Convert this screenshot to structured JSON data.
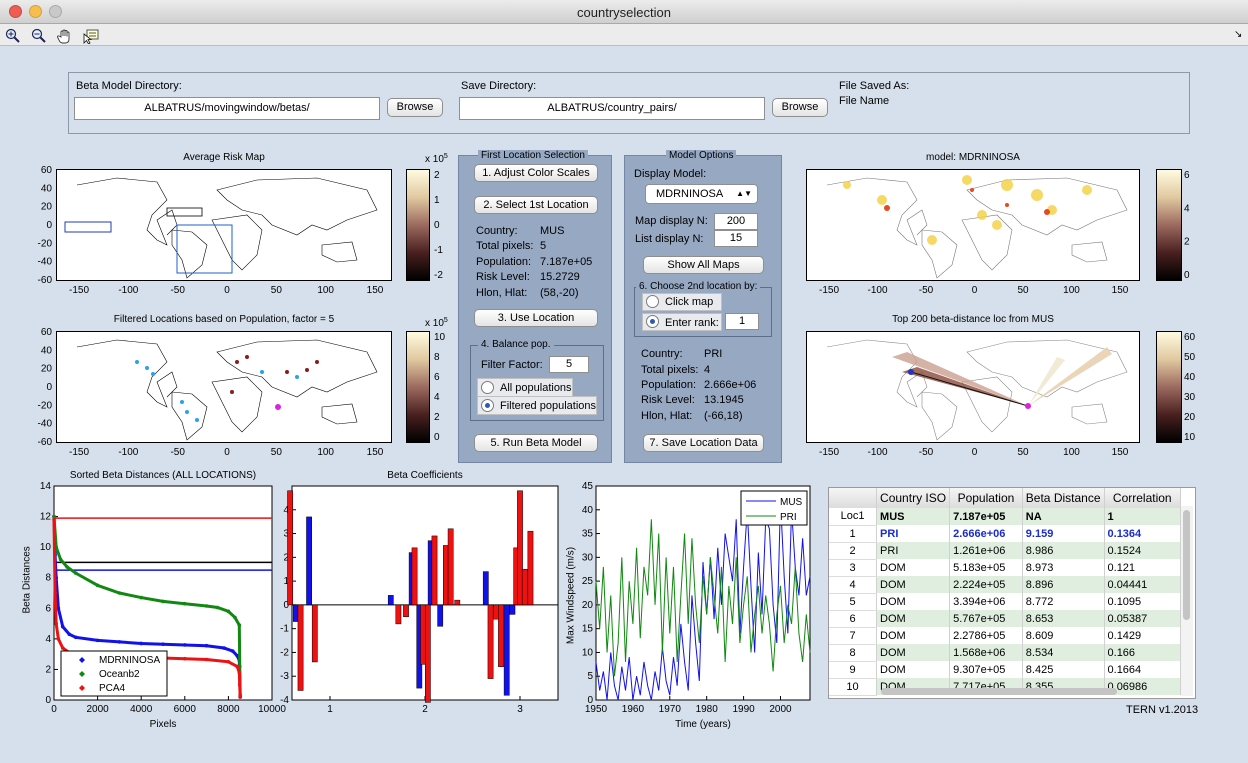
{
  "window": {
    "title": "countryselection"
  },
  "toolbar": {
    "icons": [
      "zoom-in-icon",
      "zoom-out-icon",
      "pan-hand-icon",
      "data-cursor-icon"
    ]
  },
  "dirs": {
    "beta_label": "Beta Model Directory:",
    "beta_value": "ALBATRUS/movingwindow/betas/",
    "browse": "Browse",
    "save_label": "Save Directory:",
    "save_value": "ALBATRUS/country_pairs/",
    "saved_as_label": "File Saved As:",
    "file_name": "File Name"
  },
  "maps": {
    "avg_title": "Average Risk Map",
    "avg_exp": "x 10",
    "avg_exp_pow": "5",
    "avg_cbar_ticks": [
      "2",
      "1",
      "0",
      "-1",
      "-2"
    ],
    "filtered_title": "Filtered Locations based on Population, factor = 5",
    "filtered_exp": "x 10",
    "filtered_exp_pow": "5",
    "filtered_cbar_ticks": [
      "10",
      "8",
      "6",
      "4",
      "2",
      "0"
    ],
    "model_title": "model: MDRNINOSA",
    "model_cbar_ticks": [
      "6",
      "4",
      "2",
      "0"
    ],
    "top_title": "Top 200 beta-distance loc from MUS",
    "top_cbar_ticks": [
      "60",
      "50",
      "40",
      "30",
      "20",
      "10"
    ],
    "lat_ticks": [
      "60",
      "40",
      "20",
      "0",
      "-20",
      "-40",
      "-60"
    ],
    "lon_ticks": [
      "-150",
      "-100",
      "-50",
      "0",
      "50",
      "100",
      "150"
    ]
  },
  "first_loc": {
    "title": "First Location Selection",
    "adjust": "1. Adjust Color Scales",
    "select": "2. Select 1st Location",
    "country_l": "Country:",
    "country_v": "MUS",
    "pixels_l": "Total pixels:",
    "pixels_v": "5",
    "pop_l": "Population:",
    "pop_v": "7.187e+05",
    "risk_l": "Risk Level:",
    "risk_v": "15.2729",
    "hlon_l": "Hlon, Hlat:",
    "hlon_v": "(58,-20)",
    "use": "3. Use Location",
    "balance_title": "4. Balance pop.",
    "filter_l": "Filter Factor:",
    "filter_v": "5",
    "all_pop": "All populations",
    "filtered_pop": "Filtered populations",
    "run": "5. Run Beta Model"
  },
  "model_opts": {
    "title": "Model Options",
    "display_l": "Display Model:",
    "display_v": "MDRNINOSA",
    "map_n_l": "Map display N:",
    "map_n_v": "200",
    "list_n_l": "List display N:",
    "list_n_v": "15",
    "show_all": "Show All Maps",
    "choose_title": "6. Choose 2nd location by:",
    "click_map": "Click map",
    "enter_rank": "Enter rank:",
    "rank_v": "1",
    "country_l": "Country:",
    "country_v": "PRI",
    "pixels_l": "Total pixels:",
    "pixels_v": "4",
    "pop_l": "Population:",
    "pop_v": "2.666e+06",
    "risk_l": "Risk Level:",
    "risk_v": "13.1945",
    "hlon_l": "Hlon, Hlat:",
    "hlon_v": "(-66,18)",
    "save": "7. Save Location Data"
  },
  "sorted_plot": {
    "title": "Sorted Beta Distances (ALL LOCATIONS)",
    "xlabel": "Pixels",
    "ylabel": "Beta Distances"
  },
  "beta_plot": {
    "title": "Beta Coefficients"
  },
  "ts_plot": {
    "xlabel": "Time (years)",
    "ylabel": "Max Windspeed (m/s)"
  },
  "table": {
    "headers": [
      "",
      "Country ISO",
      "Population",
      "Beta Distance",
      "Correlation"
    ],
    "rows": [
      [
        "Loc1",
        "MUS",
        "7.187e+05",
        "NA",
        "1"
      ],
      [
        "1",
        "PRI",
        "2.666e+06",
        "9.159",
        "0.1364"
      ],
      [
        "2",
        "PRI",
        "1.261e+06",
        "8.986",
        "0.1524"
      ],
      [
        "3",
        "DOM",
        "5.183e+05",
        "8.973",
        "0.121"
      ],
      [
        "4",
        "DOM",
        "2.224e+05",
        "8.896",
        "0.04441"
      ],
      [
        "5",
        "DOM",
        "3.394e+06",
        "8.772",
        "0.1095"
      ],
      [
        "6",
        "DOM",
        "5.767e+05",
        "8.653",
        "0.05387"
      ],
      [
        "7",
        "DOM",
        "2.2786+05",
        "8.609",
        "0.1429"
      ],
      [
        "8",
        "DOM",
        "1.568e+06",
        "8.534",
        "0.166"
      ],
      [
        "9",
        "DOM",
        "9.307e+05",
        "8.425",
        "0.1664"
      ],
      [
        "10",
        "DOM",
        "7.717e+05",
        "8.355",
        "0.06986"
      ]
    ]
  },
  "version": "TERN v1.2013",
  "chart_data": [
    {
      "type": "scatter",
      "title": "Sorted Beta Distances (ALL LOCATIONS)",
      "xlabel": "Pixels",
      "ylabel": "Beta Distances",
      "xlim": [
        0,
        10000
      ],
      "ylim": [
        0,
        14
      ],
      "x_ticks": [
        0,
        2000,
        4000,
        6000,
        8000,
        10000
      ],
      "y_ticks": [
        0,
        2,
        4,
        6,
        8,
        10,
        12,
        14
      ],
      "hlines": [
        {
          "y": 11.9,
          "color": "#ee1111"
        },
        {
          "y": 9.0,
          "color": "#000000"
        },
        {
          "y": 8.5,
          "color": "#1111ee"
        }
      ],
      "series": [
        {
          "name": "MDRNINOSA",
          "color": "#1111ee",
          "x": [
            0,
            50,
            100,
            200,
            400,
            700,
            1000,
            2000,
            3000,
            4000,
            5000,
            6000,
            7000,
            7800,
            8200,
            8400,
            8500,
            8520,
            8540
          ],
          "y": [
            12,
            9.5,
            8,
            6,
            4.8,
            4.3,
            4.1,
            3.9,
            3.8,
            3.7,
            3.65,
            3.6,
            3.55,
            3.4,
            3.2,
            2.9,
            2.6,
            1.5,
            0.2
          ]
        },
        {
          "name": "Oceanb2",
          "color": "#118811",
          "x": [
            0,
            100,
            300,
            600,
            1000,
            2000,
            3000,
            4000,
            5000,
            6000,
            7000,
            7500,
            8000,
            8300,
            8500,
            8520,
            8540
          ],
          "y": [
            12,
            10,
            9.2,
            8.7,
            8.3,
            7.5,
            7,
            6.7,
            6.45,
            6.3,
            6.15,
            6.05,
            5.8,
            5.4,
            4.9,
            2.2,
            0.3
          ]
        },
        {
          "name": "PCA4",
          "color": "#ee1111",
          "x": [
            0,
            50,
            100,
            200,
            400,
            700,
            1000,
            2000,
            3000,
            4000,
            5000,
            6000,
            7000,
            8000,
            8400,
            8500,
            8520,
            8540
          ],
          "y": [
            11.8,
            7,
            5,
            4,
            3.4,
            3.1,
            3,
            2.9,
            2.85,
            2.8,
            2.75,
            2.7,
            2.65,
            2.5,
            2.2,
            1.8,
            1.0,
            0.2
          ]
        }
      ],
      "legend": "bottom-left"
    },
    {
      "type": "bar",
      "title": "Beta Coefficients",
      "xlim": [
        0.6,
        3.4
      ],
      "ylim": [
        -4,
        5
      ],
      "x_ticks": [
        1,
        2,
        3
      ],
      "y_ticks": [
        -4,
        -3,
        -2,
        -1,
        0,
        1,
        2,
        3,
        4
      ],
      "bar_width": 0.055,
      "series": [
        {
          "name": "",
          "color": "#1111ee",
          "x": [
            0.64,
            0.78,
            1.64,
            1.86,
            1.94,
            2.06,
            2.16,
            2.64,
            2.86,
            2.92
          ],
          "values": [
            -0.7,
            3.7,
            0.4,
            2.2,
            -3.5,
            2.7,
            -0.9,
            1.4,
            -3.8,
            -0.4
          ]
        },
        {
          "name": "",
          "color": "#ee1111",
          "x": [
            0.58,
            0.69,
            0.84,
            1.72,
            1.8,
            1.89,
            1.98,
            2.03,
            2.1,
            2.22,
            2.27,
            2.34,
            2.69,
            2.75,
            2.8,
            2.96,
            3.0,
            3.05,
            3.11
          ],
          "values": [
            4.8,
            -3.6,
            -2.4,
            -0.8,
            -0.5,
            2.4,
            -2.5,
            -4.1,
            2.9,
            2.5,
            3.2,
            0.2,
            -3.1,
            -0.6,
            -2.6,
            2.4,
            4.8,
            1.5,
            3.1
          ]
        }
      ]
    },
    {
      "type": "line",
      "xlabel": "Time (years)",
      "ylabel": "Max Windspeed (m/s)",
      "xlim": [
        1950,
        2008
      ],
      "ylim": [
        0,
        45
      ],
      "x_ticks": [
        1950,
        1960,
        1970,
        1980,
        1990,
        2000
      ],
      "y_ticks": [
        0,
        5,
        10,
        15,
        20,
        25,
        30,
        35,
        40,
        45
      ],
      "legend": "top-right",
      "series": [
        {
          "name": "MUS",
          "color": "#1111ee",
          "x": [
            1950,
            1951,
            1952,
            1953,
            1954,
            1955,
            1956,
            1957,
            1958,
            1959,
            1960,
            1961,
            1962,
            1963,
            1964,
            1965,
            1966,
            1967,
            1968,
            1969,
            1970,
            1971,
            1972,
            1973,
            1974,
            1975,
            1976,
            1977,
            1978,
            1979,
            1980,
            1981,
            1982,
            1983,
            1984,
            1985,
            1986,
            1987,
            1988,
            1989,
            1990,
            1991,
            1992,
            1993,
            1994,
            1995,
            1996,
            1997,
            1998,
            1999,
            2000,
            2001,
            2002,
            2003,
            2004,
            2005,
            2006,
            2007,
            2008
          ],
          "y": [
            8,
            2,
            6,
            0,
            10,
            3,
            0,
            7,
            2,
            9,
            0,
            5,
            1,
            8,
            3,
            0,
            6,
            2,
            11,
            4,
            1,
            9,
            3,
            16,
            8,
            2,
            22,
            12,
            4,
            29,
            18,
            30,
            17,
            32,
            20,
            35,
            30,
            25,
            38,
            14,
            28,
            40,
            24,
            10,
            31,
            18,
            38,
            36,
            20,
            12,
            42,
            26,
            14,
            40,
            28,
            22,
            34,
            22,
            26
          ]
        },
        {
          "name": "PRI",
          "color": "#118811",
          "x": [
            1950,
            1951,
            1952,
            1953,
            1954,
            1955,
            1956,
            1957,
            1958,
            1959,
            1960,
            1961,
            1962,
            1963,
            1964,
            1965,
            1966,
            1967,
            1968,
            1969,
            1970,
            1971,
            1972,
            1973,
            1974,
            1975,
            1976,
            1977,
            1978,
            1979,
            1980,
            1981,
            1982,
            1983,
            1984,
            1985,
            1986,
            1987,
            1988,
            1989,
            1990,
            1991,
            1992,
            1993,
            1994,
            1995,
            1996,
            1997,
            1998,
            1999,
            2000,
            2001,
            2002,
            2003,
            2004,
            2005,
            2006,
            2007,
            2008
          ],
          "y": [
            25,
            15,
            28,
            10,
            22,
            5,
            12,
            30,
            8,
            25,
            16,
            32,
            13,
            28,
            22,
            38,
            20,
            35,
            10,
            30,
            14,
            28,
            8,
            22,
            35,
            16,
            34,
            20,
            12,
            26,
            18,
            30,
            22,
            14,
            28,
            8,
            24,
            16,
            30,
            12,
            20,
            26,
            10,
            18,
            24,
            14,
            22,
            16,
            6,
            18,
            24,
            12,
            20,
            16,
            28,
            14,
            8,
            18,
            10
          ]
        }
      ]
    }
  ]
}
